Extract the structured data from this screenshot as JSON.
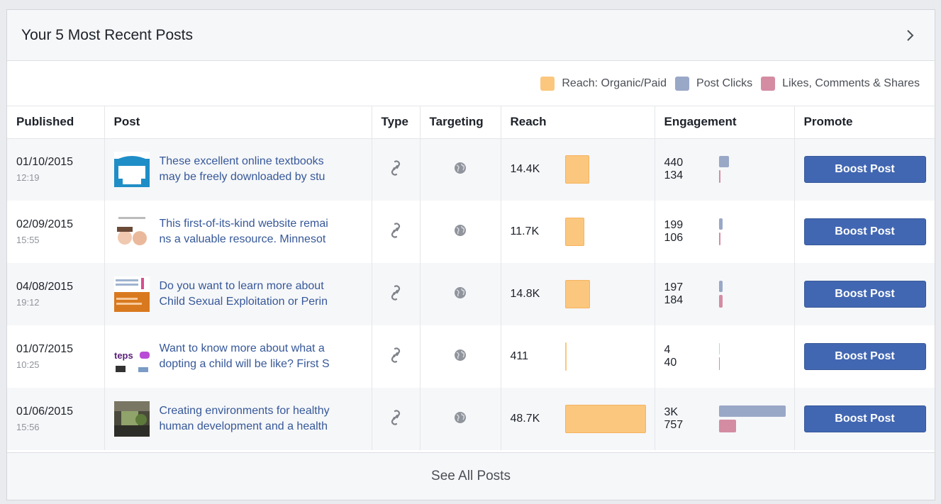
{
  "header": {
    "title": "Your 5 Most Recent Posts"
  },
  "legend": [
    {
      "label": "Reach: Organic/Paid",
      "color": "#fbc77e"
    },
    {
      "label": "Post Clicks",
      "color": "#9aa8c7"
    },
    {
      "label": "Likes, Comments & Shares",
      "color": "#d48ca3"
    }
  ],
  "columns": {
    "published": "Published",
    "post": "Post",
    "type": "Type",
    "targeting": "Targeting",
    "reach": "Reach",
    "engagement": "Engagement",
    "promote": "Promote"
  },
  "rows": [
    {
      "date": "01/10/2015",
      "time": "12:19",
      "text_line1": "These excellent online textbooks",
      "text_line2": "may be freely downloaded by stu",
      "type_icon": "link-icon",
      "targeting_icon": "globe-icon",
      "reach": "14.4K",
      "post_clicks": "440",
      "likes_comments_shares": "134",
      "boost_label": "Boost Post",
      "reach_value": 14400,
      "clicks_value": 440,
      "likes_value": 134
    },
    {
      "date": "02/09/2015",
      "time": "15:55",
      "text_line1": "This first-of-its-kind website remai",
      "text_line2": "ns a valuable resource. Minnesot",
      "type_icon": "link-icon",
      "targeting_icon": "globe-icon",
      "reach": "11.7K",
      "post_clicks": "199",
      "likes_comments_shares": "106",
      "boost_label": "Boost Post",
      "reach_value": 11700,
      "clicks_value": 199,
      "likes_value": 106
    },
    {
      "date": "04/08/2015",
      "time": "19:12",
      "text_line1": "Do you want to learn more about",
      "text_line2": "Child Sexual Exploitation or Perin",
      "type_icon": "link-icon",
      "targeting_icon": "globe-icon",
      "reach": "14.8K",
      "post_clicks": "197",
      "likes_comments_shares": "184",
      "boost_label": "Boost Post",
      "reach_value": 14800,
      "clicks_value": 197,
      "likes_value": 184
    },
    {
      "date": "01/07/2015",
      "time": "10:25",
      "text_line1": "Want to know more about what a",
      "text_line2": "dopting a child will be like? First S",
      "type_icon": "link-icon",
      "targeting_icon": "globe-icon",
      "reach": "411",
      "post_clicks": "4",
      "likes_comments_shares": "40",
      "boost_label": "Boost Post",
      "reach_value": 411,
      "clicks_value": 4,
      "likes_value": 40
    },
    {
      "date": "01/06/2015",
      "time": "15:56",
      "text_line1": "Creating environments for healthy",
      "text_line2": "human development and a health",
      "type_icon": "link-icon",
      "targeting_icon": "globe-icon",
      "reach": "48.7K",
      "post_clicks": "3K",
      "likes_comments_shares": "757",
      "boost_label": "Boost Post",
      "reach_value": 48700,
      "clicks_value": 3000,
      "likes_value": 757
    }
  ],
  "footer": {
    "see_all": "See All Posts"
  }
}
